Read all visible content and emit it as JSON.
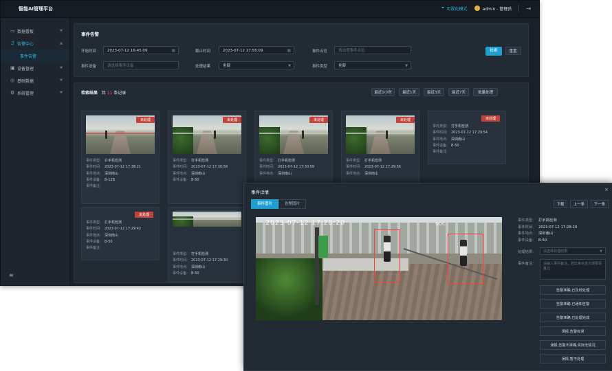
{
  "app": {
    "title": "智能AI管理平台"
  },
  "topbar": {
    "mode_label": "可视化模式",
    "user_label": "admin - 管理员"
  },
  "sidebar": {
    "items": [
      {
        "label": "数据看板"
      },
      {
        "label": "告警中心"
      },
      {
        "label": "事件告警"
      },
      {
        "label": "设备管理"
      },
      {
        "label": "基础数据"
      },
      {
        "label": "系统管理"
      }
    ]
  },
  "filter": {
    "title": "事件告警",
    "start_label": "开始时间",
    "start_value": "2023-07-12 16:45:09",
    "end_label": "截止时间",
    "end_value": "2023-07-12 17:55:09",
    "point_label": "事件点位",
    "point_placeholder": "请选择事件点位",
    "device_label": "事件设备",
    "device_placeholder": "请选择事件设备",
    "result_label": "处理结果",
    "result_value": "全部",
    "type_label": "事件类型",
    "type_value": "全部",
    "search_label": "检索",
    "reset_label": "重置"
  },
  "results": {
    "title": "检索结果",
    "count_prefix": "共",
    "count": "11",
    "count_suffix": "条记录",
    "range_buttons": [
      "最近1小时",
      "最近1天",
      "最近3天",
      "最近7天",
      "批量处理"
    ]
  },
  "card_keys": {
    "type": "事件类型:",
    "time": "事件时间:",
    "place": "事件地点:",
    "device": "事件设备:",
    "note": "事件备注:"
  },
  "cards": [
    {
      "tag": "未处理",
      "type": "打手机检测",
      "time": "2023-07-12 17:38:21",
      "place": "深圳南山",
      "device": "B-12B",
      "note": ""
    },
    {
      "tag": "未处理",
      "type": "打手机检测",
      "time": "2023-07-12 17:30:58",
      "place": "深圳南山",
      "device": "B-50"
    },
    {
      "tag": "未处理",
      "type": "打手机检测",
      "time": "2023-07-12 17:30:59",
      "place": "深圳南山"
    },
    {
      "tag": "未处理",
      "type": "打手机检测",
      "time": "2023-07-12 17:29:56",
      "place": "深圳南山"
    },
    {
      "tag": "未处理",
      "type": "打手机检测",
      "time": "2023-07-12 17:29:54",
      "place": "深圳南山",
      "device": "B-50",
      "note": ""
    },
    {
      "tag": "未处理",
      "type": "打手机检测",
      "time": "2023-07-12 17:29:42",
      "place": "深圳南山",
      "device": "B-50",
      "note": ""
    },
    {
      "tag": "未处理",
      "type": "打手机检测",
      "time": "2023-07-12 17:29:30",
      "place": "深圳南山",
      "device": "B-50"
    }
  ],
  "detail": {
    "title": "事件详情",
    "tabs": [
      "事件图片",
      "告警图片"
    ],
    "nav": [
      "下载",
      "上一条",
      "下一条"
    ],
    "osd_time": "2023-07-12 17:28:20",
    "osd_cam": "SOC",
    "type": "打手机检测",
    "time": "2023-07-12 17:28:20",
    "place": "深圳南山",
    "device": "B-50",
    "result_label": "处理结果:",
    "result_placeholder": "请选择处理结果",
    "note_label": "事件备注:",
    "note_placeholder": "请输入事件备注，若此条信息为误报请备注",
    "actions": [
      "告警准确,已及时处理",
      "告警准确,已通知告警",
      "告警准确,已处理完成",
      "误报,告警有误",
      "误报,告警不准确,实际无情况",
      "误报,暂不处理"
    ]
  }
}
